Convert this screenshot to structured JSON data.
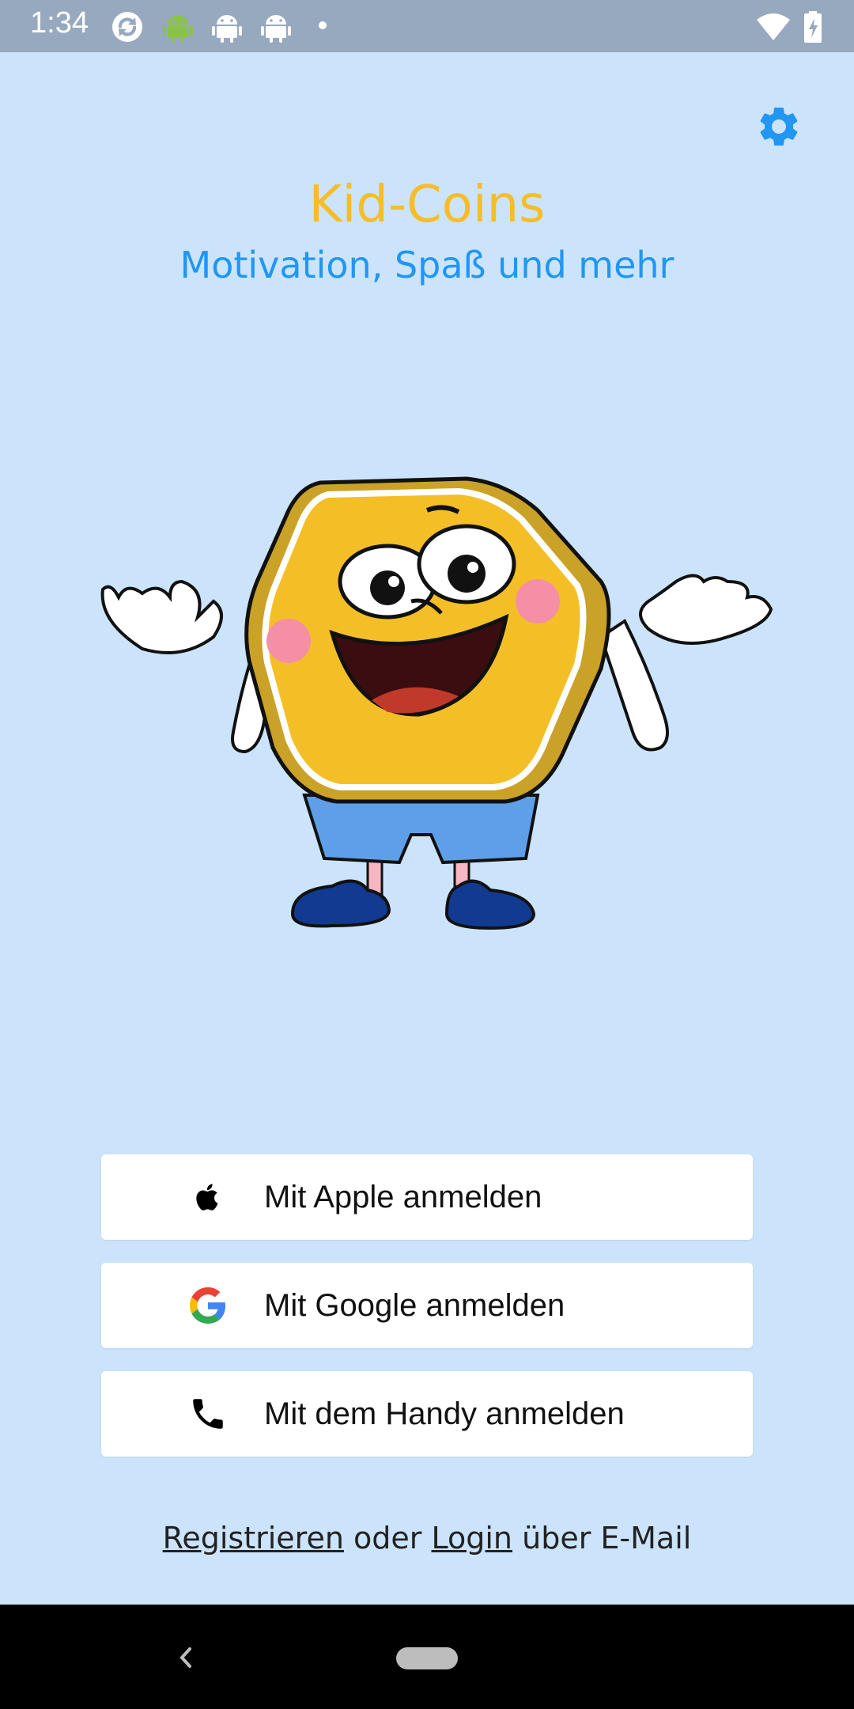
{
  "status_bar": {
    "time": "1:34",
    "icons": [
      "sync-icon",
      "android-icon",
      "android-icon",
      "android-icon",
      "dot-icon",
      "wifi-icon",
      "battery-icon"
    ]
  },
  "header": {
    "title": "Kid-Coins",
    "subtitle": "Motivation, Spaß und mehr",
    "settings_icon": "gear-icon"
  },
  "colors": {
    "background": "#cce4fb",
    "title": "#f5bd2a",
    "accent": "#2196f3",
    "status_bar": "#97a9bf"
  },
  "mascot": {
    "icon": "coin-mascot-illustration"
  },
  "buttons": [
    {
      "label": "Mit Apple anmelden",
      "icon": "apple-icon"
    },
    {
      "label": "Mit Google anmelden",
      "icon": "google-icon"
    },
    {
      "label": "Mit dem Handy anmelden",
      "icon": "phone-icon"
    }
  ],
  "footer": {
    "register_link": "Registrieren",
    "connector": "oder",
    "login_link": "Login",
    "suffix": "über E-Mail"
  },
  "nav": {
    "back_icon": "back-chevron-icon",
    "home_icon": "home-pill-icon"
  }
}
